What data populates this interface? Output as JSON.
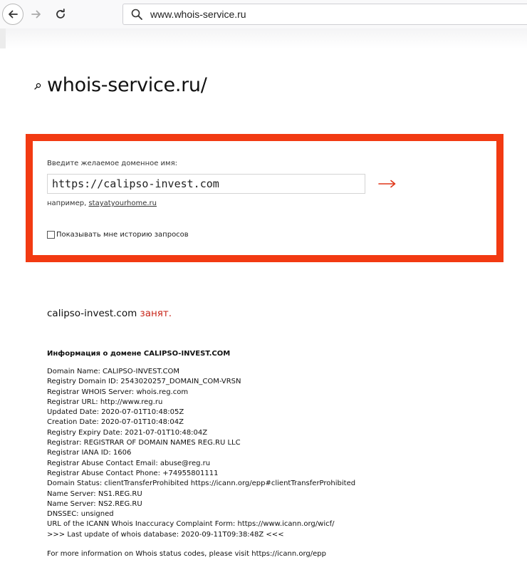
{
  "browser": {
    "url": "www.whois-service.ru"
  },
  "site": {
    "title": "whois-service.ru/"
  },
  "form": {
    "label": "Введите желаемое доменное имя:",
    "input_value": "https://calipso-invest.com",
    "example_prefix": "например,",
    "example_link": "stayatyourhome.ru",
    "history_label": "Показывать мне историю запросов",
    "accent_color": "#f23a12"
  },
  "result": {
    "domain": "calipso-invest.com",
    "status": "занят.",
    "status_color": "#c8261a"
  },
  "info": {
    "heading": "Информация о домене CALIPSO-INVEST.COM",
    "lines": [
      "Domain Name: CALIPSO-INVEST.COM",
      "Registry Domain ID: 2543020257_DOMAIN_COM-VRSN",
      "Registrar WHOIS Server: whois.reg.com",
      "Registrar URL: http://www.reg.ru",
      "Updated Date: 2020-07-01T10:48:05Z",
      "Creation Date: 2020-07-01T10:48:04Z",
      "Registry Expiry Date: 2021-07-01T10:48:04Z",
      "Registrar: REGISTRAR OF DOMAIN NAMES REG.RU LLC",
      "Registrar IANA ID: 1606",
      "Registrar Abuse Contact Email: abuse@reg.ru",
      "Registrar Abuse Contact Phone: +74955801111",
      "Domain Status: clientTransferProhibited https://icann.org/epp#clientTransferProhibited",
      "Name Server: NS1.REG.RU",
      "Name Server: NS2.REG.RU",
      "DNSSEC: unsigned",
      "URL of the ICANN Whois Inaccuracy Complaint Form: https://www.icann.org/wicf/",
      ">>> Last update of whois database: 2020-09-11T09:38:48Z <<<"
    ],
    "footer": "For more information on Whois status codes, please visit https://icann.org/epp"
  }
}
